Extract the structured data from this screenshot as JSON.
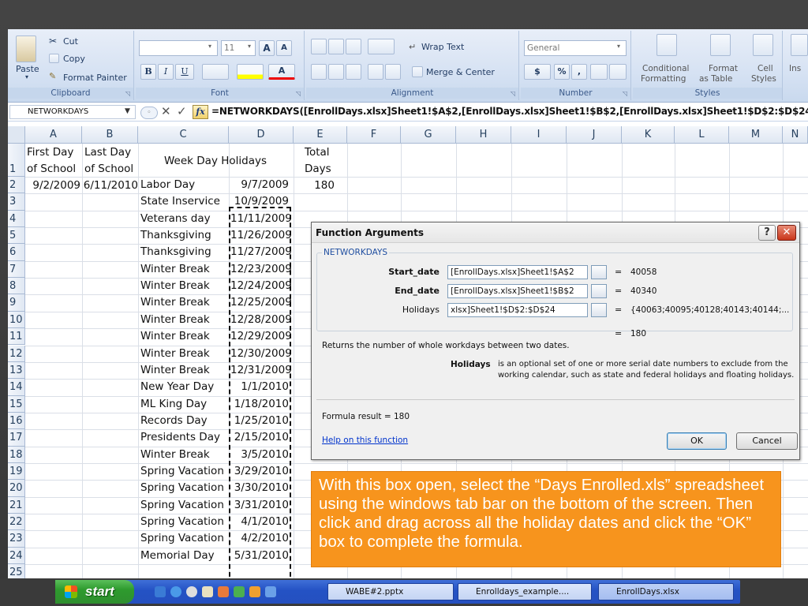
{
  "ribbon": {
    "clipboard": {
      "paste": "Paste",
      "cut": "Cut",
      "copy": "Copy",
      "format_painter": "Format Painter",
      "label": "Clipboard"
    },
    "font": {
      "font_name": "",
      "font_size": "11",
      "bold": "B",
      "italic": "I",
      "underline": "U",
      "grow": "A",
      "shrink": "A",
      "font_color": "A",
      "label": "Font"
    },
    "alignment": {
      "wrap_text": "Wrap Text",
      "merge_center": "Merge & Center",
      "label": "Alignment"
    },
    "number": {
      "format": "General",
      "currency": "$",
      "percent": "%",
      "comma": ",",
      "label": "Number"
    },
    "styles": {
      "conditional": "Conditional",
      "conditional2": "Formatting",
      "format_table": "Format",
      "format_table2": "as Table",
      "cell_styles": "Cell",
      "cell_styles2": "Styles",
      "label": "Styles"
    },
    "insert": "Ins"
  },
  "formula_bar": {
    "name_box": "NETWORKDAYS",
    "formula": "=NETWORKDAYS([EnrollDays.xlsx]Sheet1!$A$2,[EnrollDays.xlsx]Sheet1!$B$2,[EnrollDays.xlsx]Sheet1!$D$2:$D$24"
  },
  "columns": [
    "A",
    "B",
    "C",
    "D",
    "E",
    "F",
    "G",
    "H",
    "I",
    "J",
    "K",
    "L",
    "M",
    "N"
  ],
  "rows": [
    "1",
    "2",
    "3",
    "4",
    "5",
    "6",
    "7",
    "8",
    "9",
    "10",
    "11",
    "12",
    "13",
    "14",
    "15",
    "16",
    "17",
    "18",
    "19",
    "20",
    "21",
    "22",
    "23",
    "24",
    "25"
  ],
  "headers": {
    "a1_line1": "First Day",
    "a1_line2": "of School",
    "b1_line1": "Last Day",
    "b1_line2": "of School",
    "cd1": "Week Day Holidays",
    "e1_line1": "Total",
    "e1_line2": "Days"
  },
  "row2": {
    "first_day": "9/2/2009",
    "last_day": "6/11/2010",
    "total": "180"
  },
  "holidays": [
    {
      "name": "Labor Day",
      "date": "9/7/2009"
    },
    {
      "name": "State Inservice",
      "date": "10/9/2009"
    },
    {
      "name": "Veterans day",
      "date": "11/11/2009"
    },
    {
      "name": "Thanksgiving",
      "date": "11/26/2009"
    },
    {
      "name": "Thanksgiving",
      "date": "11/27/2009"
    },
    {
      "name": "Winter Break",
      "date": "12/23/2009"
    },
    {
      "name": "Winter Break",
      "date": "12/24/2009"
    },
    {
      "name": "Winter Break",
      "date": "12/25/2009"
    },
    {
      "name": "Winter Break",
      "date": "12/28/2009"
    },
    {
      "name": "Winter Break",
      "date": "12/29/2009"
    },
    {
      "name": "Winter Break",
      "date": "12/30/2009"
    },
    {
      "name": "Winter Break",
      "date": "12/31/2009"
    },
    {
      "name": "New Year Day",
      "date": "1/1/2010"
    },
    {
      "name": "ML King Day",
      "date": "1/18/2010"
    },
    {
      "name": "Records Day",
      "date": "1/25/2010"
    },
    {
      "name": "Presidents Day",
      "date": "2/15/2010"
    },
    {
      "name": "Winter Break",
      "date": "3/5/2010"
    },
    {
      "name": "Spring Vacation",
      "date": "3/29/2010"
    },
    {
      "name": "Spring Vacation",
      "date": "3/30/2010"
    },
    {
      "name": "Spring Vacation",
      "date": "3/31/2010"
    },
    {
      "name": "Spring Vacation",
      "date": "4/1/2010"
    },
    {
      "name": "Spring Vacation",
      "date": "4/2/2010"
    },
    {
      "name": "Memorial Day",
      "date": "5/31/2010"
    }
  ],
  "dialog": {
    "title": "Function Arguments",
    "help_btn": "?",
    "close_btn": "✕",
    "function_name": "NETWORKDAYS",
    "start_label": "Start_date",
    "start_value": "[EnrollDays.xlsx]Sheet1!$A$2",
    "start_result": "40058",
    "end_label": "End_date",
    "end_value": "[EnrollDays.xlsx]Sheet1!$B$2",
    "end_result": "40340",
    "holidays_label": "Holidays",
    "holidays_value": "xlsx]Sheet1!$D$2:$D$24",
    "holidays_result": "{40063;40095;40128;40143;40144;...",
    "eq": "=",
    "total_result": "180",
    "description": "Returns the number of whole workdays between two dates.",
    "arg_name": "Holidays",
    "arg_desc1": "is an optional set of one or more serial date numbers to exclude from the",
    "arg_desc2": "working calendar, such as state and federal holidays and floating holidays.",
    "formula_result": "Formula result =   180",
    "help_link": "Help on this function",
    "ok": "OK",
    "cancel": "Cancel"
  },
  "callout": "With this box open, select the “Days Enrolled.xls” spreadsheet using the windows tab bar on the bottom of the screen. Then click and drag across all the holiday dates and click the “OK” box to complete the formula.",
  "taskbar": {
    "start": "start",
    "tasks": [
      "WABE#2.pptx",
      "Enrolldays_example....",
      "EnrollDays.xlsx"
    ]
  },
  "colors": {
    "callout": "#f7941d",
    "taskbar": "#2452c4",
    "start": "#2e9b2e",
    "ribbon": "#d6e2f3"
  }
}
